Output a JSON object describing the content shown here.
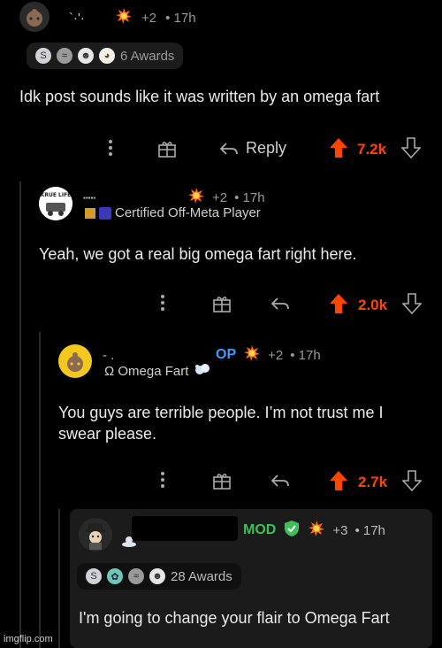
{
  "comment1": {
    "username": "`·'·",
    "award_count": "+2",
    "time": "• 17h",
    "awards_label": "6 Awards",
    "body": "Idk post sounds like it was written by an omega fart",
    "reply_label": "Reply",
    "score": "7.2k"
  },
  "comment2": {
    "username": "▪▪▪▪▪",
    "badge_text": "KRUE LIFE",
    "award_count": "+2",
    "time": "• 17h",
    "flair": "Certified Off-Meta Player",
    "body": "Yeah, we got a real big omega fart right here.",
    "score": "2.0k"
  },
  "comment3": {
    "username": "- .",
    "op_label": "OP",
    "award_count": "+2",
    "time": "• 17h",
    "flair": "Ω Omega Fart",
    "body_line1": "You guys are terrible people. I’m not trust me I",
    "body_line2": "swear please.",
    "score": "2.7k"
  },
  "comment4": {
    "mod_label": "MOD",
    "award_count": "+3",
    "time": "• 17h",
    "awards_label": "28 Awards",
    "body": "I'm going to change your flair to Omega Fart"
  },
  "watermark": "imgflip.com",
  "colors": {
    "upvote": "#ff4500",
    "op": "#3b9cff",
    "mod": "#3fbf5a"
  }
}
